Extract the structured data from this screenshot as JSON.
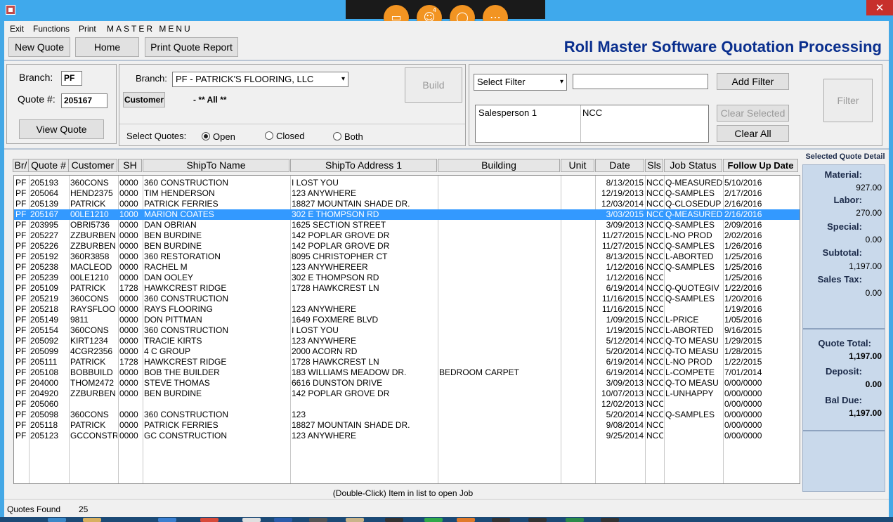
{
  "window": {
    "close_glyph": "✕"
  },
  "overlay": {
    "icons": [
      "monitor-icon",
      "user-icon",
      "chat-icon",
      "more-icon"
    ],
    "user_badge": "4"
  },
  "menu": {
    "exit": "Exit",
    "functions": "Functions",
    "print": "Print",
    "master": "MASTER MENU"
  },
  "toolbar": {
    "new_quote": "New Quote",
    "home": "Home",
    "print_report": "Print Quote Report"
  },
  "app_title": "Roll Master Software Quotation Processing",
  "quote_panel": {
    "branch_label": "Branch:",
    "branch_value": "PF",
    "quote_label": "Quote #:",
    "quote_value": "205167",
    "view_button": "View Quote"
  },
  "branch_panel": {
    "branch_label": "Branch:",
    "branch_value": "PF - PATRICK'S FLOORING, LLC",
    "customer_button": "Customer",
    "customer_value": "- ** All **",
    "build_button": "Build",
    "select_quotes_label": "Select Quotes:",
    "open": "Open",
    "closed": "Closed",
    "both": "Both",
    "selected_option": "Open"
  },
  "filter_panel": {
    "select_filter": "Select Filter",
    "filter_text": "",
    "add_filter": "Add Filter",
    "clear_selected": "Clear Selected",
    "clear_all": "Clear All",
    "filter_button": "Filter",
    "filters": [
      {
        "field": "Salesperson 1",
        "value": "NCC"
      }
    ]
  },
  "table": {
    "headers": [
      "Br/",
      "Quote #",
      "Customer",
      "SH",
      "ShipTo Name",
      "ShipTo Address 1",
      "Building",
      "Unit",
      "Date",
      "Sls",
      "Job Status",
      "Follow Up Date"
    ],
    "selected_index": 3,
    "rows": [
      [
        "PF",
        "205193",
        "360CONS",
        "0000",
        "360 CONSTRUCTION",
        "I LOST YOU",
        "",
        "",
        "8/13/2015",
        "NCC",
        "Q-MEASURED",
        "5/10/2016"
      ],
      [
        "PF",
        "205064",
        "HEND2375",
        "0000",
        "TIM HENDERSON",
        "123 ANYWHERE",
        "",
        "",
        "12/19/2013",
        "NCC",
        "Q-SAMPLES",
        "2/17/2016"
      ],
      [
        "PF",
        "205139",
        "PATRICK",
        "0000",
        "PATRICK FERRIES",
        "18827 MOUNTAIN SHADE DR.",
        "",
        "",
        "12/03/2014",
        "NCC",
        "Q-CLOSEDUP",
        "2/16/2016"
      ],
      [
        "PF",
        "205167",
        "00LE1210",
        "1000",
        "MARION COATES",
        "302 E THOMPSON RD",
        "",
        "",
        "3/03/2015",
        "NCC",
        "Q-MEASURED",
        "2/16/2016"
      ],
      [
        "PF",
        "203995",
        "OBRI5736",
        "0000",
        "DAN OBRIAN",
        "1625 SECTION STREET",
        "",
        "",
        "3/09/2013",
        "NCC",
        "Q-SAMPLES",
        "2/09/2016"
      ],
      [
        "PF",
        "205227",
        "ZZBURBEN",
        "0000",
        "BEN BURDINE",
        "142 POPLAR GROVE DR",
        "",
        "",
        "11/27/2015",
        "NCC",
        "L-NO PROD",
        "2/02/2016"
      ],
      [
        "PF",
        "205226",
        "ZZBURBEN",
        "0000",
        "BEN BURDINE",
        "142 POPLAR GROVE DR",
        "",
        "",
        "11/27/2015",
        "NCC",
        "Q-SAMPLES",
        "1/26/2016"
      ],
      [
        "PF",
        "205192",
        "360R3858",
        "0000",
        "360 RESTORATION",
        "8095 CHRISTOPHER CT",
        "",
        "",
        "8/13/2015",
        "NCC",
        "L-ABORTED",
        "1/25/2016"
      ],
      [
        "PF",
        "205238",
        "MACLEOD",
        "0000",
        "RACHEL M",
        "123 ANYWHEREER",
        "",
        "",
        "1/12/2016",
        "NCC",
        "Q-SAMPLES",
        "1/25/2016"
      ],
      [
        "PF",
        "205239",
        "00LE1210",
        "0000",
        "DAN OOLEY",
        "302 E THOMPSON RD",
        "",
        "",
        "1/12/2016",
        "NCC",
        "",
        "1/25/2016"
      ],
      [
        "PF",
        "205109",
        "PATRICK",
        "1728",
        "HAWKCREST RIDGE",
        "1728 HAWKCREST LN",
        "",
        "",
        "6/19/2014",
        "NCC",
        "Q-QUOTEGIV",
        "1/22/2016"
      ],
      [
        "PF",
        "205219",
        "360CONS",
        "0000",
        "360 CONSTRUCTION",
        "",
        "",
        "",
        "11/16/2015",
        "NCC",
        "Q-SAMPLES",
        "1/20/2016"
      ],
      [
        "PF",
        "205218",
        "RAYSFLOO",
        "0000",
        "RAYS FLOORING",
        "123 ANYWHERE",
        "",
        "",
        "11/16/2015",
        "NCC",
        "",
        "1/19/2016"
      ],
      [
        "PF",
        "205149",
        "9811",
        "0000",
        "DON PITTMAN",
        "1649 FOXMERE BLVD",
        "",
        "",
        "1/09/2015",
        "NCC",
        "L-PRICE",
        "1/05/2016"
      ],
      [
        "PF",
        "205154",
        "360CONS",
        "0000",
        "360 CONSTRUCTION",
        "I LOST YOU",
        "",
        "",
        "1/19/2015",
        "NCC",
        "L-ABORTED",
        "9/16/2015"
      ],
      [
        "PF",
        "205092",
        "KIRT1234",
        "0000",
        "TRACIE KIRTS",
        "123 ANYWHERE",
        "",
        "",
        "5/12/2014",
        "NCC",
        "Q-TO MEASU",
        "1/29/2015"
      ],
      [
        "PF",
        "205099",
        "4CGR2356",
        "0000",
        "4 C GROUP",
        "2000 ACORN RD",
        "",
        "",
        "5/20/2014",
        "NCC",
        "Q-TO MEASU",
        "1/28/2015"
      ],
      [
        "PF",
        "205111",
        "PATRICK",
        "1728",
        "HAWKCREST RIDGE",
        "1728 HAWKCREST LN",
        "",
        "",
        "6/19/2014",
        "NCC",
        "L-NO PROD",
        "1/22/2015"
      ],
      [
        "PF",
        "205108",
        "BOBBUILD",
        "0000",
        "BOB THE BUILDER",
        "183 WILLIAMS MEADOW DR.",
        "BEDROOM CARPET",
        "",
        "6/19/2014",
        "NCC",
        "L-COMPETE",
        "7/01/2014"
      ],
      [
        "PF",
        "204000",
        "THOM2472",
        "0000",
        "STEVE THOMAS",
        "6616 DUNSTON DRIVE",
        "",
        "",
        "3/09/2013",
        "NCC",
        "Q-TO MEASU",
        "0/00/0000"
      ],
      [
        "PF",
        "204920",
        "ZZBURBEN",
        "0000",
        "BEN BURDINE",
        "142 POPLAR GROVE DR",
        "",
        "",
        "10/07/2013",
        "NCC",
        "L-UNHAPPY",
        "0/00/0000"
      ],
      [
        "PF",
        "205060",
        "",
        "",
        "",
        "",
        "",
        "",
        "12/02/2013",
        "NCC",
        "",
        "0/00/0000"
      ],
      [
        "PF",
        "205098",
        "360CONS",
        "0000",
        "360 CONSTRUCTION",
        "123",
        "",
        "",
        "5/20/2014",
        "NCC",
        "Q-SAMPLES",
        "0/00/0000"
      ],
      [
        "PF",
        "205118",
        "PATRICK",
        "0000",
        "PATRICK FERRIES",
        "18827 MOUNTAIN SHADE DR.",
        "",
        "",
        "9/08/2014",
        "NCC",
        "",
        "0/00/0000"
      ],
      [
        "PF",
        "205123",
        "GCCONSTR",
        "0000",
        "GC CONSTRUCTION",
        "123 ANYWHERE",
        "",
        "",
        "9/25/2014",
        "NCC",
        "",
        "0/00/0000"
      ]
    ]
  },
  "detail": {
    "title": "Selected Quote Detail",
    "material_label": "Material:",
    "material": "927.00",
    "labor_label": "Labor:",
    "labor": "270.00",
    "special_label": "Special:",
    "special": "0.00",
    "subtotal_label": "Subtotal:",
    "subtotal": "1,197.00",
    "sales_tax_label": "Sales Tax:",
    "sales_tax": "0.00",
    "quote_total_label": "Quote Total:",
    "quote_total": "1,197.00",
    "deposit_label": "Deposit:",
    "deposit": "0.00",
    "bal_due_label": "Bal Due:",
    "bal_due": "1,197.00"
  },
  "status": {
    "hint": "(Double-Click) Item in list to open Job",
    "found_label": "Quotes Found",
    "found_value": "25"
  },
  "colors": {
    "accent": "#3399ff",
    "title": "#0a2f8e",
    "overlay_button": "#f29422",
    "detail_bg": "#c9d9eb"
  }
}
